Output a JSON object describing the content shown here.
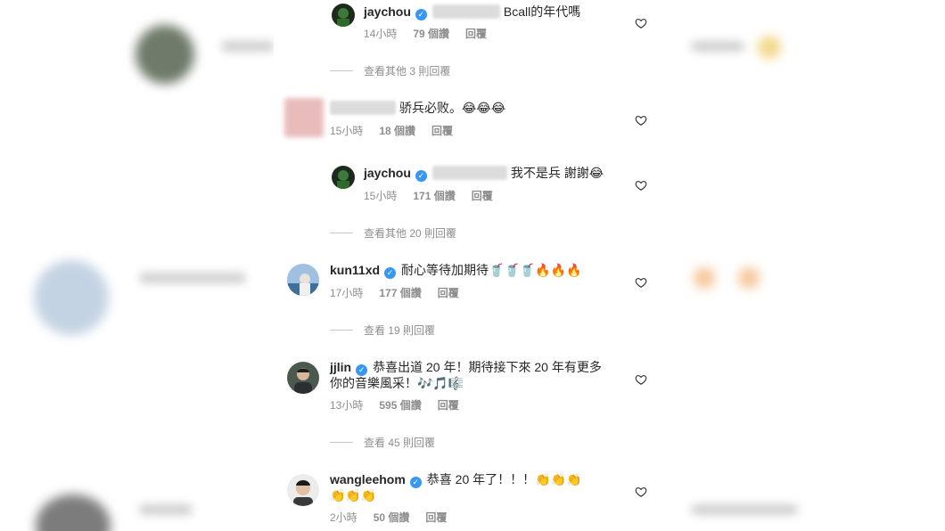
{
  "comments": [
    {
      "username": "jaychou",
      "text": "Bcall的年代嗎",
      "time": "14小時",
      "likes": "79 個讚",
      "reply": "回覆"
    },
    {
      "username": "",
      "text": "骄兵必败。😂😂😂",
      "time": "15小時",
      "likes": "18 個讚",
      "reply": "回覆"
    },
    {
      "username": "jaychou",
      "text": "我不是兵 謝謝😂",
      "time": "15小時",
      "likes": "171 個讚",
      "reply": "回覆"
    },
    {
      "username": "kun11xd",
      "text": "耐心等待加期待🥤🥤🥤🔥🔥🔥",
      "time": "17小時",
      "likes": "177 個讚",
      "reply": "回覆"
    },
    {
      "username": "jjlin",
      "text": "恭喜出道 20 年！期待接下來 20 年有更多",
      "text2": "你的音樂風采！🎶🎵🎼",
      "time": "13小時",
      "likes": "595 個讚",
      "reply": "回覆"
    },
    {
      "username": "wangleehom",
      "text": "恭喜 20 年了！！！👏👏👏",
      "text2": "👏👏👏",
      "time": "2小時",
      "likes": "50 個讚",
      "reply": "回覆"
    }
  ],
  "view_replies": [
    "查看其他 3 則回覆",
    "查看其他 20 則回覆",
    "查看 19 則回覆",
    "查看 45 則回覆"
  ],
  "colors": {
    "verified": "#3897f0",
    "meta": "#8e8e8e",
    "text": "#262626"
  }
}
